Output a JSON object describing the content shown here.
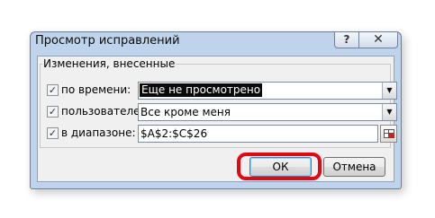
{
  "dialog": {
    "title": "Просмотр исправлений",
    "help_label": "?",
    "close_label": "✕"
  },
  "group": {
    "legend": "Изменения, внесенные"
  },
  "filters": {
    "time": {
      "checked": "✓",
      "label": "по времени:",
      "value": "Еще не просмотрено"
    },
    "user": {
      "checked": "✓",
      "label": "пользователем:",
      "value": "Все кроме меня"
    },
    "range": {
      "checked": "✓",
      "label": "в диапазоне:",
      "value": "$A$2:$C$26"
    }
  },
  "buttons": {
    "ok": "ОК",
    "cancel": "Отмена"
  },
  "icons": {
    "dropdown": "▼"
  },
  "colors": {
    "annotation_highlight": "#e30613"
  }
}
